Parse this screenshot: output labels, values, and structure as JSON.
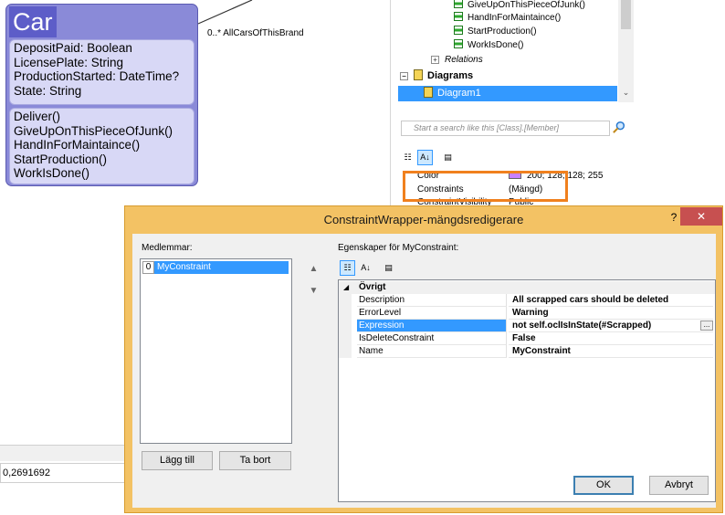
{
  "class_box": {
    "name": "Car",
    "attributes": [
      "DepositPaid: Boolean",
      "LicensePlate: String",
      "ProductionStarted: DateTime?",
      "State: String"
    ],
    "methods": [
      "Deliver()",
      "GiveUpOnThisPieceOfJunk()",
      "HandInForMaintaince()",
      "StartProduction()",
      "WorkIsDone()"
    ],
    "association_label": "0..* AllCarsOfThisBrand"
  },
  "model_tree": {
    "methods": [
      "GiveUpOnThisPieceOfJunk()",
      "HandInForMaintaince()",
      "StartProduction()",
      "WorkIsDone()"
    ],
    "relations_label": "Relations",
    "diagrams_label": "Diagrams",
    "diagram_item": "Diagram1",
    "search_placeholder": "Start a search like this [Class].[Member]"
  },
  "mini_props": {
    "color_name": "Color",
    "color_value": "200; 128; 128; 255",
    "constraints_name": "Constraints",
    "constraints_value": "(Mängd)",
    "partial_name": "ConstraintVisibility",
    "partial_value": "Public"
  },
  "status": {
    "coordinate": "0,2691692"
  },
  "dialog": {
    "title": "ConstraintWrapper-mängdsredigerare",
    "help": "?",
    "close": "✕",
    "members_label": "Medlemmar:",
    "properties_label": "Egenskaper för MyConstraint:",
    "members": [
      {
        "index": "0",
        "name": "MyConstraint"
      }
    ],
    "add_button": "Lägg till",
    "remove_button": "Ta bort",
    "ok_button": "OK",
    "cancel_button": "Avbryt",
    "category": "Övrigt",
    "properties": [
      {
        "name": "Description",
        "value": "All scrapped cars should be deleted"
      },
      {
        "name": "ErrorLevel",
        "value": "Warning"
      },
      {
        "name": "Expression",
        "value": "not self.oclIsInState(#Scrapped)"
      },
      {
        "name": "IsDeleteConstraint",
        "value": "False"
      },
      {
        "name": "Name",
        "value": "MyConstraint"
      }
    ],
    "ellipsis": "..."
  }
}
